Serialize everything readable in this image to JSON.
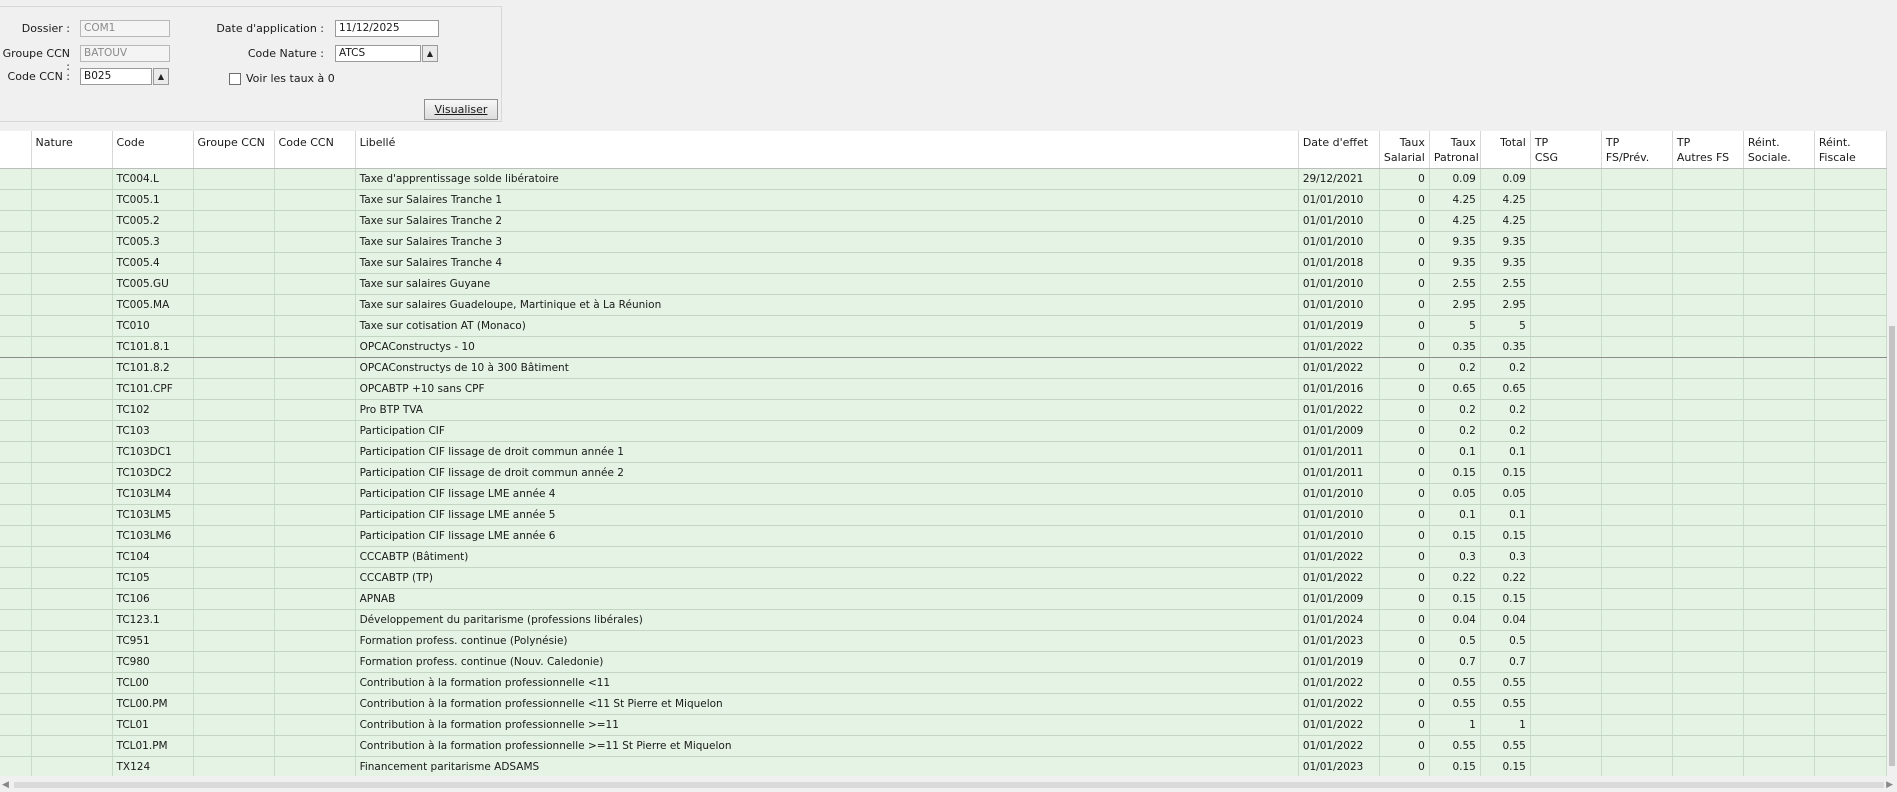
{
  "filters": {
    "dossier_label": "Dossier :",
    "dossier_value": "COM1",
    "groupe_ccn_label": "Groupe CCN :",
    "groupe_ccn_value": "BATOUV",
    "code_ccn_label": "Code CCN :",
    "code_ccn_value": "B025",
    "date_application_label": "Date d'application :",
    "date_application_value": "11/12/2025",
    "code_nature_label": "Code Nature :",
    "code_nature_value": "ATCS",
    "voir_taux_label": "Voir les taux à 0",
    "voir_taux_checked": false,
    "up_arrow_icon": "▲",
    "visualiser_label": "Visualiser"
  },
  "grid": {
    "columns": {
      "nature": "Nature",
      "code": "Code",
      "groupe_ccn": "Groupe CCN",
      "code_ccn": "Code CCN",
      "libelle": "Libellé",
      "date_effet": "Date d'effet",
      "taux_salarial_1": "Taux",
      "taux_salarial_2": "Salarial",
      "taux_patronal_1": "Taux",
      "taux_patronal_2": "Patronal",
      "total": "Total",
      "tp_csg_1": "TP",
      "tp_csg_2": "CSG",
      "tp_fs_1": "TP",
      "tp_fs_2": "FS/Prév.",
      "tp_autres_1": "TP",
      "tp_autres_2": "Autres FS",
      "reint_soc_1": "Réint.",
      "reint_soc_2": "Sociale.",
      "reint_fisc_1": "Réint.",
      "reint_fisc_2": "Fiscale"
    },
    "rows": [
      {
        "code": "TC004.L",
        "libelle": "Taxe d'apprentissage solde libératoire",
        "date": "29/12/2021",
        "sal": "0",
        "pat": "0.09",
        "total": "0.09"
      },
      {
        "code": "TC005.1",
        "libelle": "Taxe sur Salaires Tranche 1",
        "date": "01/01/2010",
        "sal": "0",
        "pat": "4.25",
        "total": "4.25"
      },
      {
        "code": "TC005.2",
        "libelle": "Taxe sur Salaires Tranche 2",
        "date": "01/01/2010",
        "sal": "0",
        "pat": "4.25",
        "total": "4.25"
      },
      {
        "code": "TC005.3",
        "libelle": "Taxe sur Salaires Tranche 3",
        "date": "01/01/2010",
        "sal": "0",
        "pat": "9.35",
        "total": "9.35"
      },
      {
        "code": "TC005.4",
        "libelle": "Taxe sur Salaires Tranche 4",
        "date": "01/01/2018",
        "sal": "0",
        "pat": "9.35",
        "total": "9.35"
      },
      {
        "code": "TC005.GU",
        "libelle": "Taxe sur salaires Guyane",
        "date": "01/01/2010",
        "sal": "0",
        "pat": "2.55",
        "total": "2.55"
      },
      {
        "code": "TC005.MA",
        "libelle": "Taxe sur salaires Guadeloupe, Martinique et à La Réunion",
        "date": "01/01/2010",
        "sal": "0",
        "pat": "2.95",
        "total": "2.95"
      },
      {
        "code": "TC010",
        "libelle": "Taxe sur cotisation AT (Monaco)",
        "date": "01/01/2019",
        "sal": "0",
        "pat": "5",
        "total": "5"
      },
      {
        "code": "TC101.8.1",
        "libelle": "OPCAConstructys - 10",
        "date": "01/01/2022",
        "sal": "0",
        "pat": "0.35",
        "total": "0.35"
      },
      {
        "code": "TC101.8.2",
        "libelle": "OPCAConstructys de 10 à 300 Bâtiment",
        "date": "01/01/2022",
        "sal": "0",
        "pat": "0.2",
        "total": "0.2"
      },
      {
        "code": "TC101.CPF",
        "libelle": "OPCABTP +10 sans CPF",
        "date": "01/01/2016",
        "sal": "0",
        "pat": "0.65",
        "total": "0.65"
      },
      {
        "code": "TC102",
        "libelle": "Pro BTP TVA",
        "date": "01/01/2022",
        "sal": "0",
        "pat": "0.2",
        "total": "0.2"
      },
      {
        "code": "TC103",
        "libelle": "Participation CIF",
        "date": "01/01/2009",
        "sal": "0",
        "pat": "0.2",
        "total": "0.2"
      },
      {
        "code": "TC103DC1",
        "libelle": "Participation CIF lissage de droit commun année 1",
        "date": "01/01/2011",
        "sal": "0",
        "pat": "0.1",
        "total": "0.1"
      },
      {
        "code": "TC103DC2",
        "libelle": "Participation CIF lissage de droit commun année 2",
        "date": "01/01/2011",
        "sal": "0",
        "pat": "0.15",
        "total": "0.15"
      },
      {
        "code": "TC103LM4",
        "libelle": "Participation CIF lissage LME année 4",
        "date": "01/01/2010",
        "sal": "0",
        "pat": "0.05",
        "total": "0.05"
      },
      {
        "code": "TC103LM5",
        "libelle": "Participation CIF lissage LME année 5",
        "date": "01/01/2010",
        "sal": "0",
        "pat": "0.1",
        "total": "0.1"
      },
      {
        "code": "TC103LM6",
        "libelle": "Participation CIF lissage LME année 6",
        "date": "01/01/2010",
        "sal": "0",
        "pat": "0.15",
        "total": "0.15"
      },
      {
        "code": "TC104",
        "libelle": "CCCABTP (Bâtiment)",
        "date": "01/01/2022",
        "sal": "0",
        "pat": "0.3",
        "total": "0.3"
      },
      {
        "code": "TC105",
        "libelle": "CCCABTP (TP)",
        "date": "01/01/2022",
        "sal": "0",
        "pat": "0.22",
        "total": "0.22"
      },
      {
        "code": "TC106",
        "libelle": "APNAB",
        "date": "01/01/2009",
        "sal": "0",
        "pat": "0.15",
        "total": "0.15"
      },
      {
        "code": "TC123.1",
        "libelle": "Développement du paritarisme (professions libérales)",
        "date": "01/01/2024",
        "sal": "0",
        "pat": "0.04",
        "total": "0.04"
      },
      {
        "code": "TC951",
        "libelle": "Formation profess. continue (Polynésie)",
        "date": "01/01/2023",
        "sal": "0",
        "pat": "0.5",
        "total": "0.5"
      },
      {
        "code": "TC980",
        "libelle": "Formation profess. continue (Nouv. Caledonie)",
        "date": "01/01/2019",
        "sal": "0",
        "pat": "0.7",
        "total": "0.7"
      },
      {
        "code": "TCL00",
        "libelle": "Contribution à la formation professionnelle <11",
        "date": "01/01/2022",
        "sal": "0",
        "pat": "0.55",
        "total": "0.55"
      },
      {
        "code": "TCL00.PM",
        "libelle": "Contribution à la formation professionnelle <11 St Pierre et Miquelon",
        "date": "01/01/2022",
        "sal": "0",
        "pat": "0.55",
        "total": "0.55"
      },
      {
        "code": "TCL01",
        "libelle": "Contribution à la formation professionnelle >=11",
        "date": "01/01/2022",
        "sal": "0",
        "pat": "1",
        "total": "1"
      },
      {
        "code": "TCL01.PM",
        "libelle": "Contribution à la formation professionnelle >=11 St Pierre et Miquelon",
        "date": "01/01/2022",
        "sal": "0",
        "pat": "0.55",
        "total": "0.55"
      },
      {
        "code": "TX124",
        "libelle": "Financement paritarisme ADSAMS",
        "date": "01/01/2023",
        "sal": "0",
        "pat": "0.15",
        "total": "0.15"
      }
    ],
    "focused_row_index": 8
  },
  "scrollbars": {
    "left_arrow_icon": "◀",
    "right_arrow_icon": "▶"
  },
  "colors": {
    "row_background": "#e4f3e4",
    "panel_background": "#f0f0f0"
  }
}
